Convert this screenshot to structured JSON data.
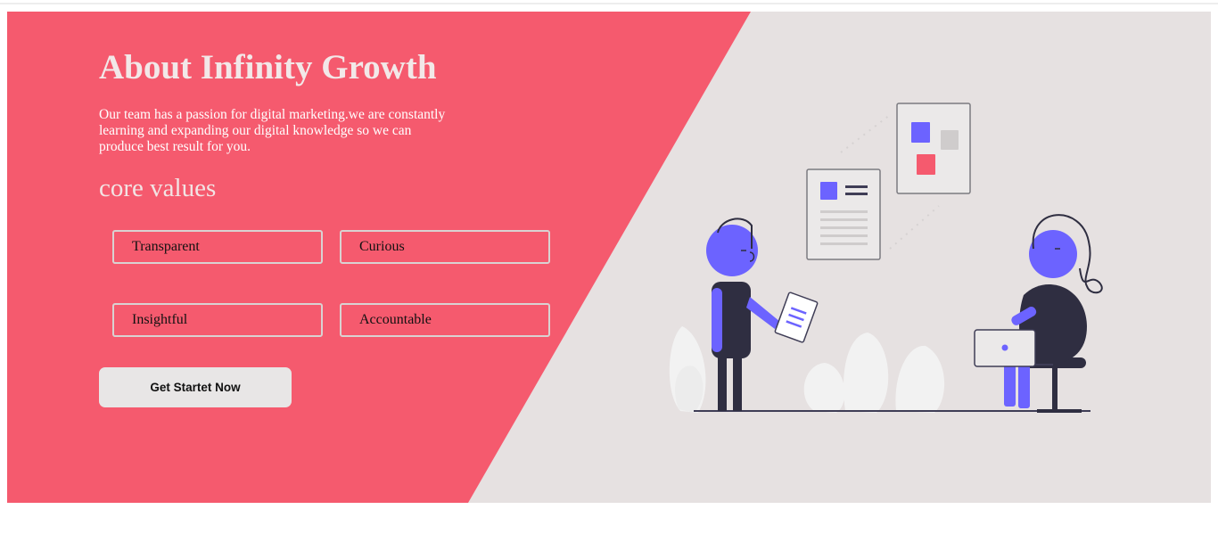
{
  "colors": {
    "accent": "#f55a6e",
    "panel_background": "#e6e1e1",
    "button_background": "#e8e6e6",
    "illustration_purple": "#6c63ff",
    "illustration_dark": "#2f2e41"
  },
  "about": {
    "title": "About Infinity Growth",
    "description": "Our team has a passion for digital marketing.we are constantly learning and expanding our digital knowledge so we can produce best result for you.",
    "values_heading": "core values",
    "values": [
      "Transparent",
      "Curious",
      "Insightful",
      "Accountable"
    ],
    "cta_label": "Get Startet Now"
  },
  "illustration": {
    "icon": "team-collaboration-illustration"
  }
}
